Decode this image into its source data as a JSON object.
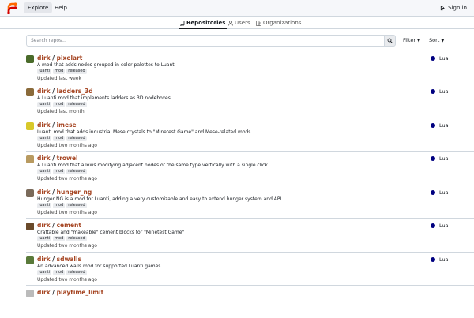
{
  "colors": {
    "accent": "#a54421",
    "lua_dot": "#000080",
    "topbar_bg": "#f6f7fa"
  },
  "topbar": {
    "logo_icon": "forgejo-logo-icon",
    "explore_label": "Explore",
    "help_label": "Help",
    "signin_label": "Sign in",
    "signin_icon": "sign-in-icon"
  },
  "tabs": [
    {
      "label": "Repositories",
      "icon": "repo-icon",
      "active": true
    },
    {
      "label": "Users",
      "icon": "person-icon",
      "active": false
    },
    {
      "label": "Organizations",
      "icon": "organization-icon",
      "active": false
    }
  ],
  "search": {
    "placeholder": "Search repos...",
    "value": "",
    "button_icon": "search-icon"
  },
  "filter_label": "Filter",
  "sort_label": "Sort",
  "repos": [
    {
      "owner": "dirk",
      "name": "pixelart",
      "description": "A mod that adds nodes grouped in color palettes to Luanti",
      "tags": [
        "luanti",
        "mod",
        "released"
      ],
      "updated": "Updated last week",
      "language": "Lua",
      "avatar_color": "#4a6b2a"
    },
    {
      "owner": "dirk",
      "name": "ladders_3d",
      "description": "A Luanti mod that implements ladders as 3D nodeboxes",
      "tags": [
        "luanti",
        "mod",
        "released"
      ],
      "updated": "Updated last month",
      "language": "Lua",
      "avatar_color": "#8a6a3a"
    },
    {
      "owner": "dirk",
      "name": "imese",
      "description": "Luanti mod that adds industrial Mese crystals to \"Minetest Game\" and Mese-related mods",
      "tags": [
        "luanti",
        "mod",
        "released"
      ],
      "updated": "Updated two months ago",
      "language": "Lua",
      "avatar_color": "#d8c82a"
    },
    {
      "owner": "dirk",
      "name": "trowel",
      "description": "A Luanti mod that allows modifying adjacent nodes of the same type vertically with a single click.",
      "tags": [
        "luanti",
        "mod",
        "released"
      ],
      "updated": "Updated two months ago",
      "language": "Lua",
      "avatar_color": "#b89a60"
    },
    {
      "owner": "dirk",
      "name": "hunger_ng",
      "description": "Hunger NG is a mod for Luanti, adding a very customizable and easy to extend hunger system and API",
      "tags": [
        "luanti",
        "mod",
        "released"
      ],
      "updated": "Updated two months ago",
      "language": "Lua",
      "avatar_color": "#7a6a5a"
    },
    {
      "owner": "dirk",
      "name": "cement",
      "description": "Craftable and \"makeable\" cement blocks for \"Minetest Game\"",
      "tags": [
        "luanti",
        "mod",
        "released"
      ],
      "updated": "Updated two months ago",
      "language": "Lua",
      "avatar_color": "#6a4a2a"
    },
    {
      "owner": "dirk",
      "name": "sdwalls",
      "description": "An advanced walls mod for supported Luanti games",
      "tags": [
        "luanti",
        "mod",
        "released"
      ],
      "updated": "Updated two months ago",
      "language": "Lua",
      "avatar_color": "#5a7a3a"
    },
    {
      "owner": "dirk",
      "name": "playtime_limit",
      "description": "",
      "tags": [],
      "updated": "",
      "language": "",
      "avatar_color": "#bbbbbb"
    }
  ]
}
